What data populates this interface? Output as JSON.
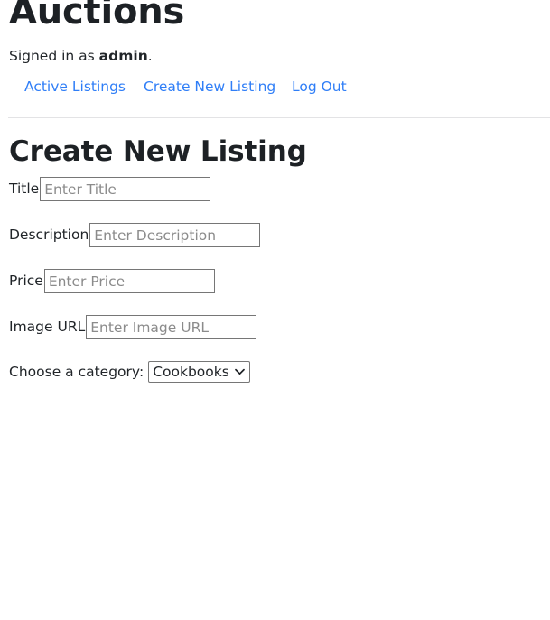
{
  "header": {
    "site_title": "Auctions",
    "signed_in_prefix": "Signed in as ",
    "username": "admin",
    "signed_in_suffix": "."
  },
  "nav": {
    "links": [
      {
        "label": "Active Listings"
      },
      {
        "label": "Create New Listing"
      },
      {
        "label": "Log Out"
      }
    ]
  },
  "main": {
    "form_title": "Create New Listing",
    "fields": [
      {
        "label": "Title",
        "placeholder": "Enter Title",
        "value": ""
      },
      {
        "label": "Description",
        "placeholder": "Enter Description",
        "value": ""
      },
      {
        "label": "Price",
        "placeholder": "Enter Price",
        "value": ""
      },
      {
        "label": "Image URL",
        "placeholder": "Enter Image URL",
        "value": ""
      }
    ],
    "category": {
      "label": "Choose a category:",
      "selected": "Cookbooks",
      "icon": "chevron-down-icon"
    }
  },
  "colors": {
    "link": "#2f7ef7",
    "heading": "#1d2125",
    "text": "#212529",
    "input_border": "#767676",
    "placeholder": "#8b8b8b",
    "divider": "#e3e3e5",
    "background": "#ffffff"
  }
}
